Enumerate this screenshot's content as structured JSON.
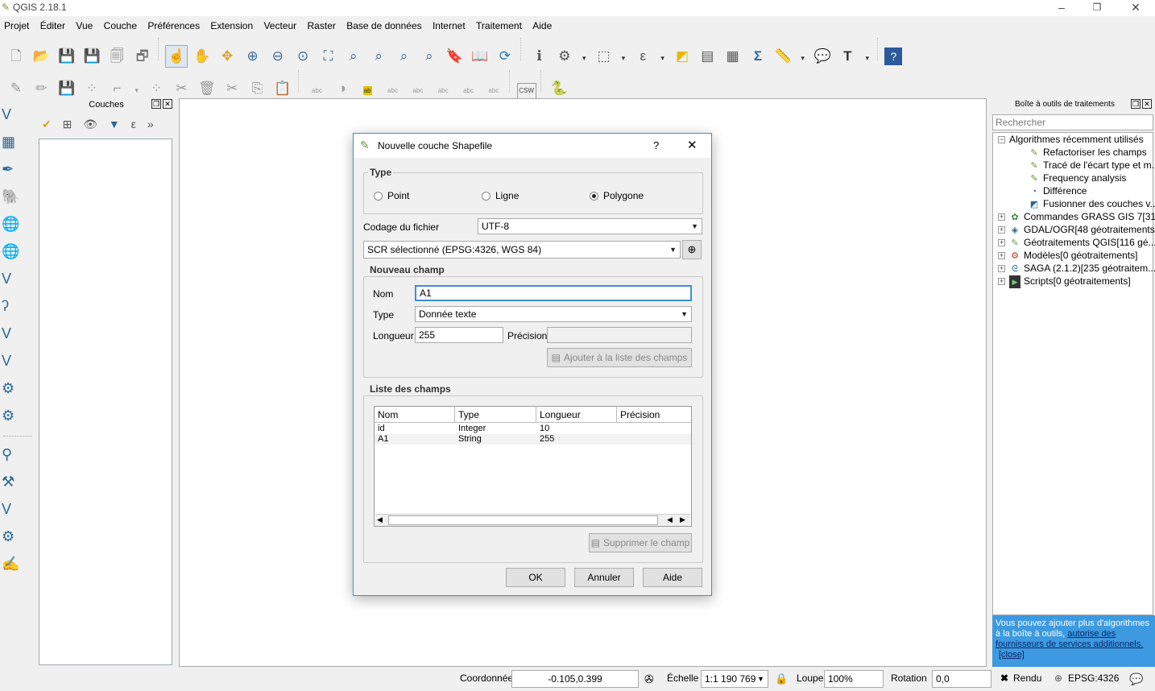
{
  "window": {
    "title": "QGIS 2.18.1"
  },
  "menu": [
    "Projet",
    "Éditer",
    "Vue",
    "Couche",
    "Préférences",
    "Extension",
    "Vecteur",
    "Raster",
    "Base de données",
    "Internet",
    "Traitement",
    "Aide"
  ],
  "layers_panel": {
    "title": "Couches"
  },
  "processing_panel": {
    "title": "Boîte à outils de traitements",
    "search_placeholder": "Rechercher",
    "tree": [
      {
        "label": "Algorithmes récemment utilisés",
        "level": 0,
        "expander": "−"
      },
      {
        "label": "Refactoriser les champs",
        "level": 1
      },
      {
        "label": "Tracé de l'écart type et m...",
        "level": 1
      },
      {
        "label": "Frequency analysis",
        "level": 1
      },
      {
        "label": "Différence",
        "level": 1
      },
      {
        "label": "Fusionner des couches v...",
        "level": 1
      },
      {
        "label": "Commandes GRASS GIS 7[31...",
        "level": 0,
        "expander": "+"
      },
      {
        "label": "GDAL/OGR[48 géotraitements]",
        "level": 0,
        "expander": "+"
      },
      {
        "label": "Géotraitements QGIS[116 gé...",
        "level": 0,
        "expander": "+"
      },
      {
        "label": "Modèles[0 géotraitements]",
        "level": 0,
        "expander": "+"
      },
      {
        "label": "SAGA (2.1.2)[235 géotraitem...",
        "level": 0,
        "expander": "+"
      },
      {
        "label": "Scripts[0 géotraitements]",
        "level": 0,
        "expander": "+"
      }
    ],
    "info_text": "Vous pouvez ajouter plus d'algorithmes à la boîte à outils,",
    "info_link": "autorise des fournisseurs de services additionnels.",
    "info_close": "[close]"
  },
  "dialog": {
    "title": "Nouvelle couche Shapefile",
    "help": "?",
    "type_group": "Type",
    "types": [
      {
        "label": "Point",
        "checked": false
      },
      {
        "label": "Ligne",
        "checked": false
      },
      {
        "label": "Polygone",
        "checked": true
      }
    ],
    "encoding_label": "Codage du fichier",
    "encoding_value": "UTF-8",
    "crs_value": "SCR sélectionné (EPSG:4326, WGS 84)",
    "new_field_group": "Nouveau champ",
    "name_label": "Nom",
    "name_value": "A1",
    "type_label": "Type",
    "type_value": "Donnée texte",
    "length_label": "Longueur",
    "length_value": "255",
    "precision_label": "Précision",
    "precision_value": "",
    "add_button": "Ajouter à la liste des champs",
    "list_group": "Liste des champs",
    "columns": [
      "Nom",
      "Type",
      "Longueur",
      "Précision"
    ],
    "rows": [
      [
        "id",
        "Integer",
        "10",
        ""
      ],
      [
        "A1",
        "String",
        "255",
        ""
      ]
    ],
    "remove_button": "Supprimer le champ",
    "ok": "OK",
    "cancel": "Annuler",
    "help_button": "Aide"
  },
  "status": {
    "coord_label": "Coordonnée",
    "coord_value": "-0.105,0.399",
    "scale_label": "Échelle",
    "scale_value": "1:1 190 769",
    "zoom_label": "Loupe",
    "zoom_value": "100%",
    "rotation_label": "Rotation",
    "rotation_value": "0,0",
    "render_label": "Rendu",
    "epsg": "EPSG:4326"
  }
}
